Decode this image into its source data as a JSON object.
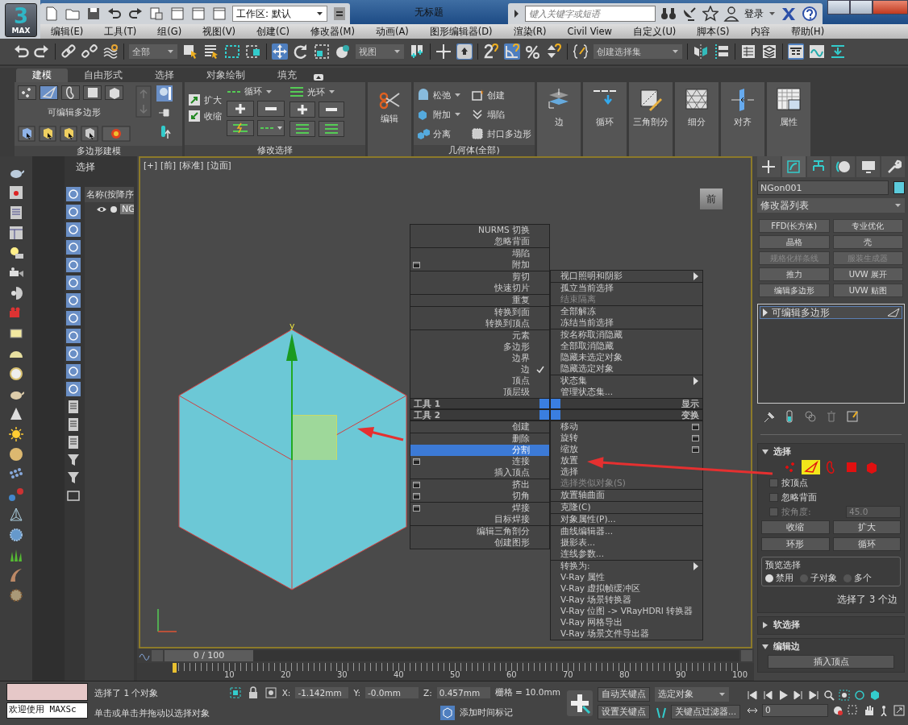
{
  "title_bar": {
    "logo": "3",
    "logo_caption": "MAX",
    "workspace": "工作区: 默认",
    "title": "无标题",
    "search": {
      "placeholder": "键入关键字或短语"
    },
    "sign_in": "登录"
  },
  "menu_bar": [
    "编辑(E)",
    "工具(T)",
    "组(G)",
    "视图(V)",
    "创建(C)",
    "修改器(M)",
    "动画(A)",
    "图形编辑器(D)",
    "渲染(R)",
    "Civil View",
    "自定义(U)",
    "脚本(S)",
    "内容",
    "帮助(H)"
  ],
  "main_toolbar": {
    "selection_filter": "全部",
    "reference_coordinate": "视图",
    "named_selection": "创建选择集"
  },
  "ribbon": {
    "tabs": [
      {
        "label": "建模",
        "selected": true
      },
      {
        "label": "自由形式",
        "selected": false
      },
      {
        "label": "选择",
        "selected": false
      },
      {
        "label": "对象绘制",
        "selected": false
      },
      {
        "label": "填充",
        "selected": false
      }
    ],
    "polygon_modeling": {
      "subobjects": [
        {
          "kind": "vertex",
          "selected": false
        },
        {
          "kind": "edge",
          "selected": true
        },
        {
          "kind": "border",
          "selected": false
        },
        {
          "kind": "polygon",
          "selected": false
        },
        {
          "kind": "element",
          "selected": false
        }
      ],
      "object_label": "可编辑多边形",
      "footer": "多边形建模"
    },
    "modify_selection": {
      "grow": "扩大",
      "shrink": "收缩",
      "loop": "循环",
      "ring": "光环",
      "footer": "修改选择"
    },
    "edit": "编辑",
    "geometry": {
      "items": [
        "松弛",
        "创建",
        "附加",
        "塌陷",
        "分离",
        "封口多边形"
      ],
      "footer": "几何体(全部)"
    },
    "tool_buttons": [
      {
        "kind": "edge",
        "label": "边"
      },
      {
        "kind": "loop",
        "label": "循环"
      },
      {
        "kind": "triangulate",
        "label": "三角剖分"
      },
      {
        "kind": "subdivide",
        "label": "细分"
      },
      {
        "kind": "align",
        "label": "对齐"
      },
      {
        "kind": "properties",
        "label": "属性"
      }
    ]
  },
  "scene_explorer": {
    "title": "选择",
    "column": "名称(按降序",
    "items": [
      "NG"
    ]
  },
  "viewport": {
    "labels": [
      "[+]",
      "[前]",
      "[标准]",
      "[边面]"
    ],
    "view_cube": "前",
    "gizmo_axis": "y"
  },
  "quad_menu": {
    "quadrants": [
      {
        "kind": "top-left",
        "header": "工具 1",
        "groups": [
          [
            {
              "label": "NURMS 切换",
              "selected": false
            },
            {
              "label": "忽略背面",
              "selected": false
            }
          ],
          [
            {
              "label": "塌陷",
              "selected": false
            },
            {
              "label": "附加",
              "selected": false,
              "options": true
            }
          ],
          [
            {
              "label": "剪切",
              "selected": false
            },
            {
              "label": "快速切片",
              "selected": false
            }
          ],
          [
            {
              "label": "重复",
              "selected": false
            }
          ],
          [
            {
              "label": "转换到面",
              "selected": false
            },
            {
              "label": "转换到顶点",
              "selected": false
            }
          ],
          [
            {
              "label": "元素",
              "selected": false
            },
            {
              "label": "多边形",
              "selected": false
            },
            {
              "label": "边界",
              "selected": false
            },
            {
              "label": "边",
              "selected": false,
              "checked": true
            },
            {
              "label": "顶点",
              "selected": false
            },
            {
              "label": "顶层级",
              "selected": false
            }
          ]
        ]
      },
      {
        "kind": "top-right",
        "header": "显示",
        "groups": [
          [
            {
              "label": "视口照明和阴影",
              "selected": false,
              "submenu": true
            }
          ],
          [
            {
              "label": "孤立当前选择",
              "selected": false
            },
            {
              "label": "结束隔离",
              "selected": false,
              "disabled": true
            }
          ],
          [
            {
              "label": "全部解冻",
              "selected": false
            },
            {
              "label": "冻结当前选择",
              "selected": false
            }
          ],
          [
            {
              "label": "按名称取消隐藏",
              "selected": false
            },
            {
              "label": "全部取消隐藏",
              "selected": false
            },
            {
              "label": "隐藏未选定对象",
              "selected": false
            },
            {
              "label": "隐藏选定对象",
              "selected": false
            }
          ],
          [
            {
              "label": "状态集",
              "selected": false,
              "submenu": true
            },
            {
              "label": "管理状态集...",
              "selected": false
            }
          ]
        ]
      },
      {
        "kind": "bottom-left",
        "header": "工具 2",
        "groups": [
          [
            {
              "label": "创建",
              "selected": false
            }
          ],
          [
            {
              "label": "删除",
              "selected": false
            },
            {
              "label": "分割",
              "selected": true
            },
            {
              "label": "连接",
              "selected": false,
              "options": true
            },
            {
              "label": "插入顶点",
              "selected": false
            }
          ],
          [
            {
              "label": "挤出",
              "selected": false,
              "options": true
            },
            {
              "label": "切角",
              "selected": false,
              "options": true
            }
          ],
          [
            {
              "label": "焊接",
              "selected": false,
              "options": true
            },
            {
              "label": "目标焊接",
              "selected": false
            }
          ],
          [
            {
              "label": "编辑三角剖分",
              "selected": false
            },
            {
              "label": "创建图形",
              "selected": false
            }
          ]
        ]
      },
      {
        "kind": "bottom-right",
        "header": "变换",
        "groups": [
          [
            {
              "label": "移动",
              "selected": false,
              "options": true
            },
            {
              "label": "旋转",
              "selected": false,
              "options": true
            },
            {
              "label": "缩放",
              "selected": false,
              "options": true
            },
            {
              "label": "放置",
              "selected": false
            },
            {
              "label": "选择",
              "selected": false
            },
            {
              "label": "选择类似对象(S)",
              "selected": false,
              "disabled": true
            }
          ],
          [
            {
              "label": "放置轴曲面",
              "selected": false
            }
          ],
          [
            {
              "label": "克隆(C)",
              "selected": false
            }
          ],
          [
            {
              "label": "对象属性(P)...",
              "selected": false
            }
          ],
          [
            {
              "label": "曲线编辑器...",
              "selected": false
            },
            {
              "label": "摄影表...",
              "selected": false
            },
            {
              "label": "连线参数...",
              "selected": false
            }
          ],
          [
            {
              "label": "转换为:",
              "selected": false,
              "submenu": true
            },
            {
              "label": "V-Ray 属性",
              "selected": false
            },
            {
              "label": "V-Ray 虚拟帧缓冲区",
              "selected": false
            },
            {
              "label": "V-Ray 场景转换器",
              "selected": false
            },
            {
              "label": "V-Ray 位图 -> VRayHDRI 转换器",
              "selected": false
            },
            {
              "label": "V-Ray 网格导出",
              "selected": false
            },
            {
              "label": "V-Ray 场景文件导出器",
              "selected": false
            }
          ]
        ]
      }
    ]
  },
  "command_panel": {
    "tabs": [
      {
        "kind": "create",
        "selected": false
      },
      {
        "kind": "modify",
        "selected": true
      },
      {
        "kind": "hierarchy",
        "selected": false
      },
      {
        "kind": "motion",
        "selected": false
      },
      {
        "kind": "display",
        "selected": false
      },
      {
        "kind": "utilities",
        "selected": false
      }
    ],
    "object_name": "NGon001",
    "modifier_list": "修改器列表",
    "modifier_buttons": [
      {
        "label": "FFD(长方体)",
        "disabled": false
      },
      {
        "label": "专业优化",
        "disabled": false
      },
      {
        "label": "晶格",
        "disabled": false
      },
      {
        "label": "壳",
        "disabled": false
      },
      {
        "label": "规格化样条线",
        "disabled": true
      },
      {
        "label": "服装生成器",
        "disabled": true
      },
      {
        "label": "推力",
        "disabled": false
      },
      {
        "label": "UVW 展开",
        "disabled": false
      },
      {
        "label": "编辑多边形",
        "disabled": false
      },
      {
        "label": "UVW 贴图",
        "disabled": false
      }
    ],
    "stack": [
      {
        "label": "可编辑多边形",
        "selected": true
      }
    ],
    "selection": {
      "title": "选择",
      "subobjects": [
        {
          "kind": "vertex",
          "selected": false
        },
        {
          "kind": "edge",
          "selected": true
        },
        {
          "kind": "border",
          "selected": false
        },
        {
          "kind": "polygon",
          "selected": false
        },
        {
          "kind": "element",
          "selected": false
        }
      ],
      "checkboxes": [
        {
          "label": "按顶点",
          "checked": false,
          "disabled": false
        },
        {
          "label": "忽略背面",
          "checked": false,
          "disabled": false
        },
        {
          "label": "按角度:",
          "checked": false,
          "disabled": true,
          "value": "45.0"
        }
      ],
      "buttons": [
        "收缩",
        "扩大"
      ],
      "spin_buttons": [
        "环形",
        "循环"
      ],
      "preview": {
        "title": "预览选择",
        "options": [
          {
            "label": "禁用",
            "selected": true
          },
          {
            "label": "子对象",
            "selected": false
          },
          {
            "label": "多个",
            "selected": false
          }
        ]
      },
      "summary": "选择了 3 个边"
    },
    "rollouts": [
      {
        "title": "软选择",
        "expanded": false
      },
      {
        "title": "编辑边",
        "expanded": true,
        "buttons": [
          "插入顶点"
        ]
      }
    ]
  },
  "time_slider": {
    "position": "0 / 100",
    "level": 0,
    "ticks": [
      "10",
      "20",
      "30",
      "40",
      "50",
      "60",
      "70",
      "80",
      "90",
      "100"
    ]
  },
  "status_bar": {
    "listener_input": "欢迎使用 MAXSc",
    "message": "选择了 1 个对象",
    "prompt": "单击或单击并拖动以选择对象",
    "coords": [
      {
        "axis": "X:",
        "value": "-1.142mm"
      },
      {
        "axis": "Y:",
        "value": "-0.0mm"
      },
      {
        "axis": "Z:",
        "value": "0.457mm"
      }
    ],
    "grid": "栅格 = 10.0mm",
    "add_time_tag": "添加时间标记",
    "auto_key": "自动关键点",
    "set_key": "设置关键点",
    "key_target": "选定对象",
    "key_filters": "关键点过滤器...",
    "frame": "0"
  }
}
